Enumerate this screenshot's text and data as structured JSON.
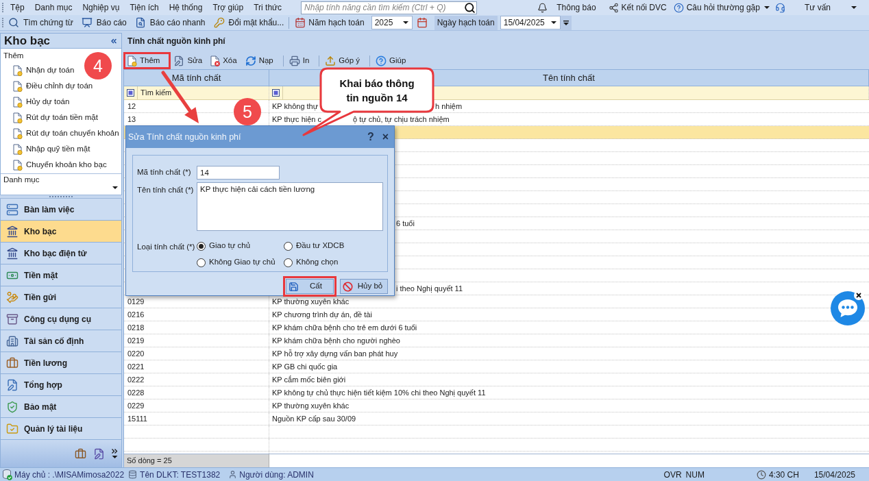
{
  "menu_bar": {
    "items": [
      "Tệp",
      "Danh mục",
      "Nghiệp vụ",
      "Tiện ích",
      "Hệ thống",
      "Trợ giúp",
      "Tri thức"
    ],
    "search": {
      "placeholder": "Nhập tính năng cần tìm kiếm (Ctrl + Q)"
    },
    "links": [
      {
        "label": "Thông báo",
        "dropdown": false
      },
      {
        "label": "Kết nối DVC",
        "dropdown": false
      },
      {
        "label": "Câu hỏi thường gặp",
        "dropdown": true
      },
      {
        "label": "Tư vấn",
        "dropdown": true
      }
    ]
  },
  "toolbar": {
    "buttons": [
      "Tìm chứng từ",
      "Báo cáo",
      "Báo cáo nhanh",
      "Đổi mật khẩu..."
    ],
    "fiscal_year": {
      "label": "Năm hạch toán",
      "value": "2025"
    },
    "posting_date": {
      "label": "Ngày hạch toán",
      "value": "15/04/2025"
    }
  },
  "sidebar": {
    "title": "Kho bạc",
    "quick_add": {
      "title": "Thêm",
      "items": [
        "Nhận dự toán",
        "Điều chỉnh dự toán",
        "Hủy dự toán",
        "Rút dự toán tiền mặt",
        "Rút dự toán chuyển khoản",
        "Nhập quỹ tiền mặt",
        "Chuyển khoản kho bạc"
      ]
    },
    "catalog": {
      "title": "Danh mục"
    },
    "modules": [
      {
        "label": "Bàn làm việc",
        "selected": false
      },
      {
        "label": "Kho bạc",
        "selected": true
      },
      {
        "label": "Kho bạc điện tử",
        "selected": false
      },
      {
        "label": "Tiền mặt",
        "selected": false
      },
      {
        "label": "Tiền gửi",
        "selected": false
      },
      {
        "label": "Công cụ dụng cụ",
        "selected": false
      },
      {
        "label": "Tài sản cố định",
        "selected": false
      },
      {
        "label": "Tiền lương",
        "selected": false
      },
      {
        "label": "Tổng hợp",
        "selected": false
      },
      {
        "label": "Bảo mật",
        "selected": false
      },
      {
        "label": "Quản lý tài liệu",
        "selected": false
      }
    ]
  },
  "page": {
    "title": "Tính chất nguồn kinh phí",
    "action_groups": [
      [
        {
          "label": "Thêm",
          "highlighted": true
        },
        {
          "label": "Sửa",
          "highlighted": false
        },
        {
          "label": "Xóa",
          "highlighted": false
        },
        {
          "label": "Nạp",
          "highlighted": false
        }
      ],
      [
        {
          "label": "In",
          "highlighted": false
        }
      ],
      [
        {
          "label": "Góp ý",
          "highlighted": false
        }
      ],
      [
        {
          "label": "Giúp",
          "highlighted": false
        }
      ]
    ],
    "grid": {
      "columns": [
        "Mã tính chất",
        "Tên tính chất"
      ],
      "filter": {
        "placeholder": "Tìm kiếm"
      },
      "rows": [
        {
          "kind": "split",
          "code": "12",
          "name": [
            "KP không thự",
            "h nhiệm"
          ],
          "selected": false
        },
        {
          "kind": "split",
          "code": "13",
          "name": [
            "KP thực hiện c",
            "ộ tự chủ, tự chịu trách nhiệm"
          ],
          "selected": false
        },
        {
          "kind": "covered",
          "selected": true
        },
        {
          "kind": "covered",
          "selected": false
        },
        {
          "kind": "covered",
          "selected": false
        },
        {
          "kind": "covered",
          "selected": false
        },
        {
          "kind": "covered",
          "selected": false
        },
        {
          "kind": "covered",
          "selected": false
        },
        {
          "kind": "covered",
          "selected": false
        },
        {
          "kind": "covered",
          "name": "6 tuổi",
          "selected": false
        },
        {
          "kind": "covered",
          "selected": false
        },
        {
          "kind": "covered",
          "selected": false
        },
        {
          "kind": "covered",
          "selected": false
        },
        {
          "kind": "covered",
          "selected": false
        },
        {
          "kind": "covered",
          "name": "i theo Nghị quyết 11",
          "selected": false
        },
        {
          "kind": "plain",
          "code": "0129",
          "name": "KP thường xuyên khác",
          "selected": false
        },
        {
          "kind": "plain",
          "code": "0216",
          "name": "KP chương trình dự án, đề tài",
          "selected": false
        },
        {
          "kind": "plain",
          "code": "0218",
          "name": "KP khám chữa bệnh cho trẻ em dưới 6 tuổi",
          "selected": false
        },
        {
          "kind": "plain",
          "code": "0219",
          "name": "KP khám chữa bệnh cho người nghèo",
          "selected": false
        },
        {
          "kind": "plain",
          "code": "0220",
          "name": "KP hỗ trợ xây dựng vấn ban phát huy",
          "selected": false
        },
        {
          "kind": "plain",
          "code": "0221",
          "name": "KP GB chi quốc gia",
          "selected": false
        },
        {
          "kind": "plain",
          "code": "0222",
          "name": "KP cắm mốc biên giới",
          "selected": false
        },
        {
          "kind": "plain",
          "code": "0228",
          "name": "KP không tự chủ thực hiện tiết kiệm 10% chi theo Nghị quyết 11",
          "selected": false
        },
        {
          "kind": "plain",
          "code": "0229",
          "name": "KP thường xuyên khác",
          "selected": false
        },
        {
          "kind": "plain",
          "code": "15111",
          "name": "Nguồn KP cấp sau 30/09",
          "selected": false
        }
      ],
      "footer": "Số dòng = 25"
    }
  },
  "dialog": {
    "title": "Sửa Tính chất nguồn kinh phí",
    "title_buttons": [
      "?",
      "×"
    ],
    "fields": [
      {
        "kind": "text",
        "label": "Mã tính chất (*)",
        "value": "14"
      },
      {
        "kind": "multiline",
        "label": "Tên tính chất (*)",
        "value": "KP thực hiện cải cách tiền lương"
      }
    ],
    "type_field": {
      "label": "Loại tính chất (*)",
      "options": [
        {
          "label": "Giao tự chủ",
          "selected": true
        },
        {
          "label": "Đầu tư XDCB",
          "selected": false
        },
        {
          "label": "Không Giao tự chủ",
          "selected": false
        },
        {
          "label": "Không chọn",
          "selected": false
        }
      ]
    },
    "buttons": [
      {
        "label": "Cất",
        "highlighted": true
      },
      {
        "label": "Hủy bỏ",
        "highlighted": false
      }
    ]
  },
  "annotations": {
    "steps": [
      "4",
      "5"
    ],
    "callout": "Khai báo thông tin nguồn 14"
  },
  "status_bar": {
    "server": "Máy chủ : .\\MISAMimosa2022",
    "database": "Tên DLKT: TEST1382",
    "user": "Người dùng: ADMIN",
    "indicators": [
      "OVR",
      "NUM"
    ],
    "time": "4:30 CH",
    "date": "15/04/2025"
  }
}
